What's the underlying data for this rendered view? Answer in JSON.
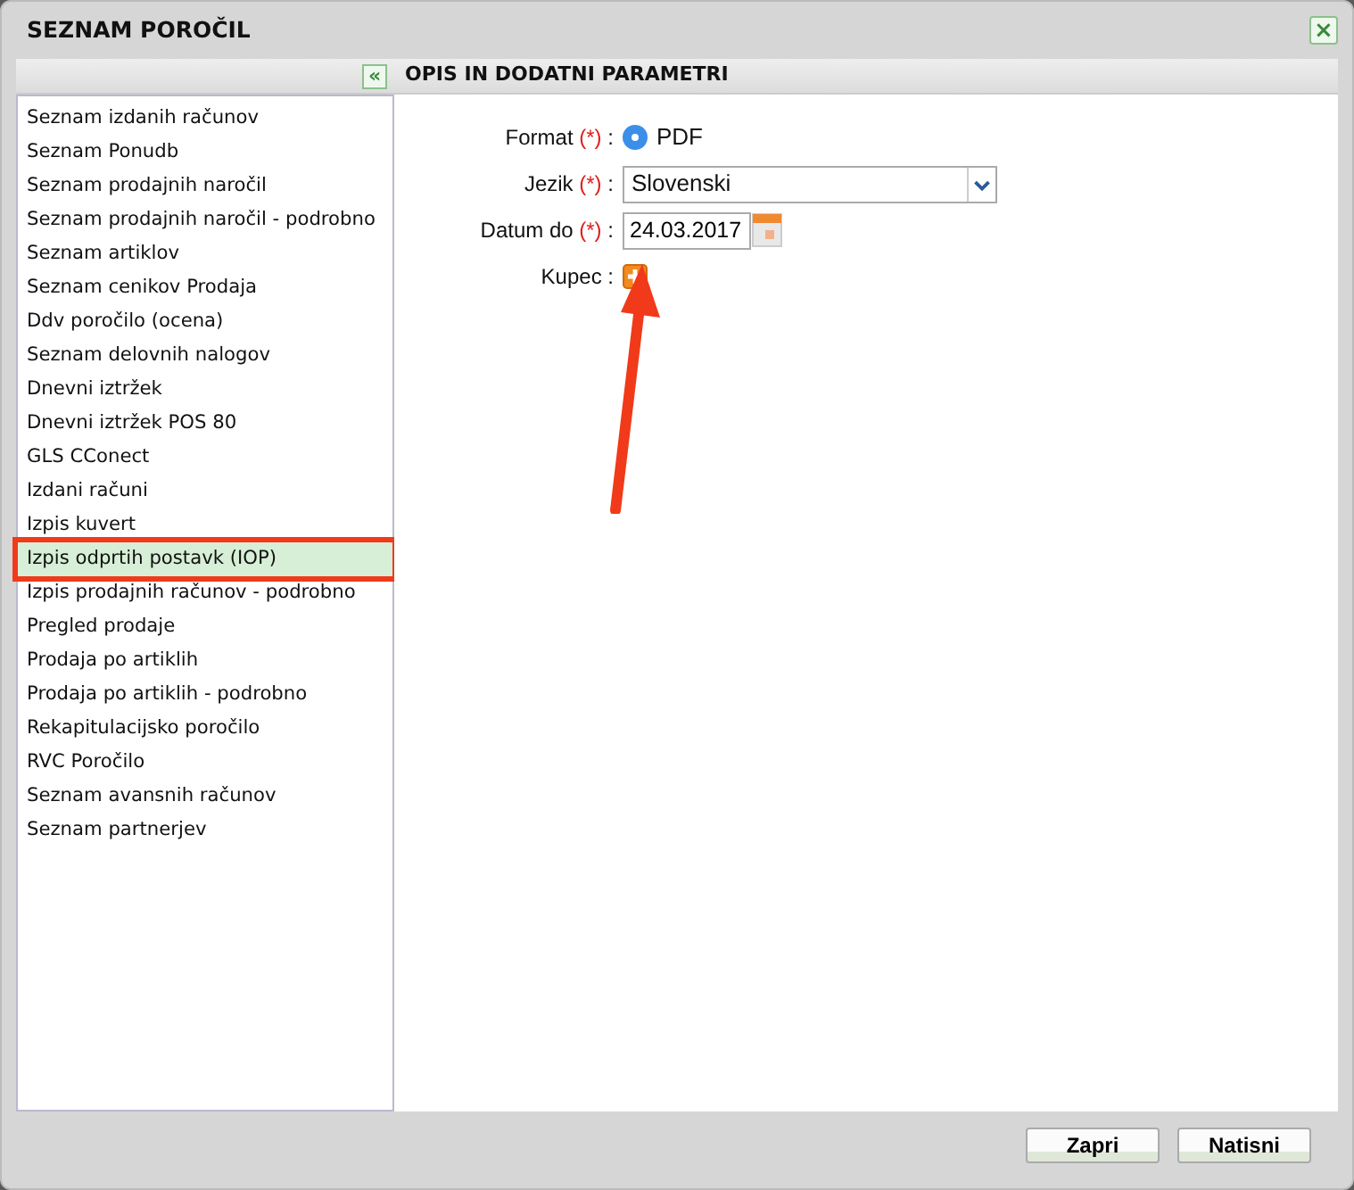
{
  "window": {
    "title": "SEZNAM POROČIL",
    "close": "×"
  },
  "left_panel": {
    "collapse": "«",
    "items": [
      {
        "label": "Seznam izdanih računov",
        "selected": false
      },
      {
        "label": "Seznam Ponudb",
        "selected": false
      },
      {
        "label": "Seznam prodajnih naročil",
        "selected": false
      },
      {
        "label": "Seznam prodajnih naročil - podrobno",
        "selected": false
      },
      {
        "label": "Seznam artiklov",
        "selected": false
      },
      {
        "label": "Seznam cenikov Prodaja",
        "selected": false
      },
      {
        "label": "Ddv poročilo (ocena)",
        "selected": false
      },
      {
        "label": "Seznam delovnih nalogov",
        "selected": false
      },
      {
        "label": "Dnevni iztržek",
        "selected": false
      },
      {
        "label": "Dnevni iztržek POS 80",
        "selected": false
      },
      {
        "label": "GLS CConect",
        "selected": false
      },
      {
        "label": "Izdani računi",
        "selected": false
      },
      {
        "label": "Izpis kuvert",
        "selected": false
      },
      {
        "label": "Izpis odprtih postavk (IOP)",
        "selected": true
      },
      {
        "label": "Izpis prodajnih računov - podrobno",
        "selected": false
      },
      {
        "label": "Pregled prodaje",
        "selected": false
      },
      {
        "label": "Prodaja po artiklih",
        "selected": false
      },
      {
        "label": "Prodaja po artiklih - podrobno",
        "selected": false
      },
      {
        "label": "Rekapitulacijsko poročilo",
        "selected": false
      },
      {
        "label": "RVC Poročilo",
        "selected": false
      },
      {
        "label": "Seznam avansnih računov",
        "selected": false
      },
      {
        "label": "Seznam partnerjev",
        "selected": false
      }
    ]
  },
  "right_panel": {
    "title": "OPIS IN DODATNI PARAMETRI",
    "fields": [
      {
        "kind": "radio",
        "label": "Format",
        "required": "(*)",
        "separator": ":",
        "value": "PDF",
        "checked": true
      },
      {
        "kind": "select",
        "label": "Jezik",
        "required": "(*)",
        "separator": ":",
        "value": "Slovenski"
      },
      {
        "kind": "date",
        "label": "Datum do",
        "required": "(*)",
        "separator": ":",
        "value": "24.03.2017"
      },
      {
        "kind": "add",
        "label": "Kupec",
        "separator": ":"
      }
    ]
  },
  "buttons": [
    "Zapri",
    "Natisni"
  ]
}
